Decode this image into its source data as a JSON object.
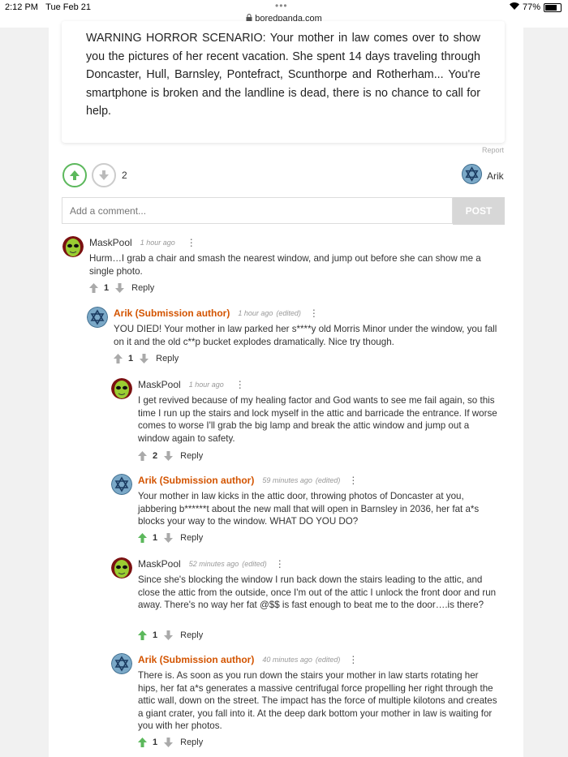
{
  "status_bar": {
    "time": "2:12 PM",
    "date": "Tue Feb 21",
    "dots": "•••",
    "url": "boredpanda.com",
    "battery": "77%"
  },
  "post": {
    "text": "WARNING HORROR SCENARIO: Your mother in law comes over to show you the pictures of her recent vacation. She spent 14 days traveling through Doncaster, Hull, Barnsley, Pontefract, Scunthorpe and Rotherham... You're smartphone is broken and the landline is dead, there is no chance to call for help.",
    "report": "Report",
    "votes": "2",
    "author": "Arik"
  },
  "comment_form": {
    "placeholder": "Add a comment...",
    "post_label": "POST"
  },
  "comments": [
    {
      "name": "MaskPool",
      "time": "1 hour ago",
      "edited": "",
      "menu": "⋮",
      "text": "Hurm…I grab a chair and smash the nearest window, and jump out before she can show me a single photo.",
      "votes": "1",
      "reply": "Reply",
      "up_color": "#aaaaaa"
    },
    {
      "name": "Arik (Submission author)",
      "time": "1 hour ago",
      "edited": "(edited)",
      "menu": "⋮",
      "text": "YOU DIED! Your mother in law parked her s****y old Morris Minor under the window, you fall on it and the old c**p bucket explodes dramatically. Nice try though.",
      "votes": "1",
      "reply": "Reply",
      "up_color": "#aaaaaa"
    },
    {
      "name": "MaskPool",
      "time": "1 hour ago",
      "edited": "",
      "menu": "⋮",
      "text": "I get revived because of my healing factor and God wants to see me fail again, so this time I run up the stairs and lock myself in the attic and barricade the entrance. If worse comes to worse I'll grab the big lamp and break the attic window and jump out a window again to safety.",
      "votes": "2",
      "reply": "Reply",
      "up_color": "#aaaaaa"
    },
    {
      "name": "Arik (Submission author)",
      "time": "59 minutes ago",
      "edited": "(edited)",
      "menu": "⋮",
      "text": "Your mother in law kicks in the attic door, throwing photos of Doncaster at you, jabbering b******t about the new mall that will open in Barnsley in 2036, her fat a*s blocks your way to the window. WHAT DO YOU DO?",
      "votes": "1",
      "reply": "Reply",
      "up_color": "#5cb85c"
    },
    {
      "name": "MaskPool",
      "time": "52 minutes ago",
      "edited": "(edited)",
      "menu": "⋮",
      "text": "Since she's blocking the window I run back down the stairs leading to the attic, and close the attic from the outside, once I'm out of the attic I unlock the front door and run away. There's no way her fat @$$ is fast enough to beat me to the door….is there?",
      "votes": "1",
      "reply": "Reply",
      "up_color": "#5cb85c"
    },
    {
      "name": "Arik (Submission author)",
      "time": "40 minutes ago",
      "edited": "(edited)",
      "menu": "⋮",
      "text": "There is. As soon as you run down the stairs your mother in law starts rotating her hips, her fat a*s generates a massive centrifugal force propelling her right through the attic wall, down on the street. The impact has the force of multiple kilotons and creates a giant crater, you fall into it. At the deep dark bottom your mother in law is waiting for you with her photos.",
      "votes": "1",
      "reply": "Reply",
      "up_color": "#5cb85c"
    }
  ],
  "colors": {
    "upvote_active": "#5cb85c",
    "author_name": "#d35400"
  }
}
